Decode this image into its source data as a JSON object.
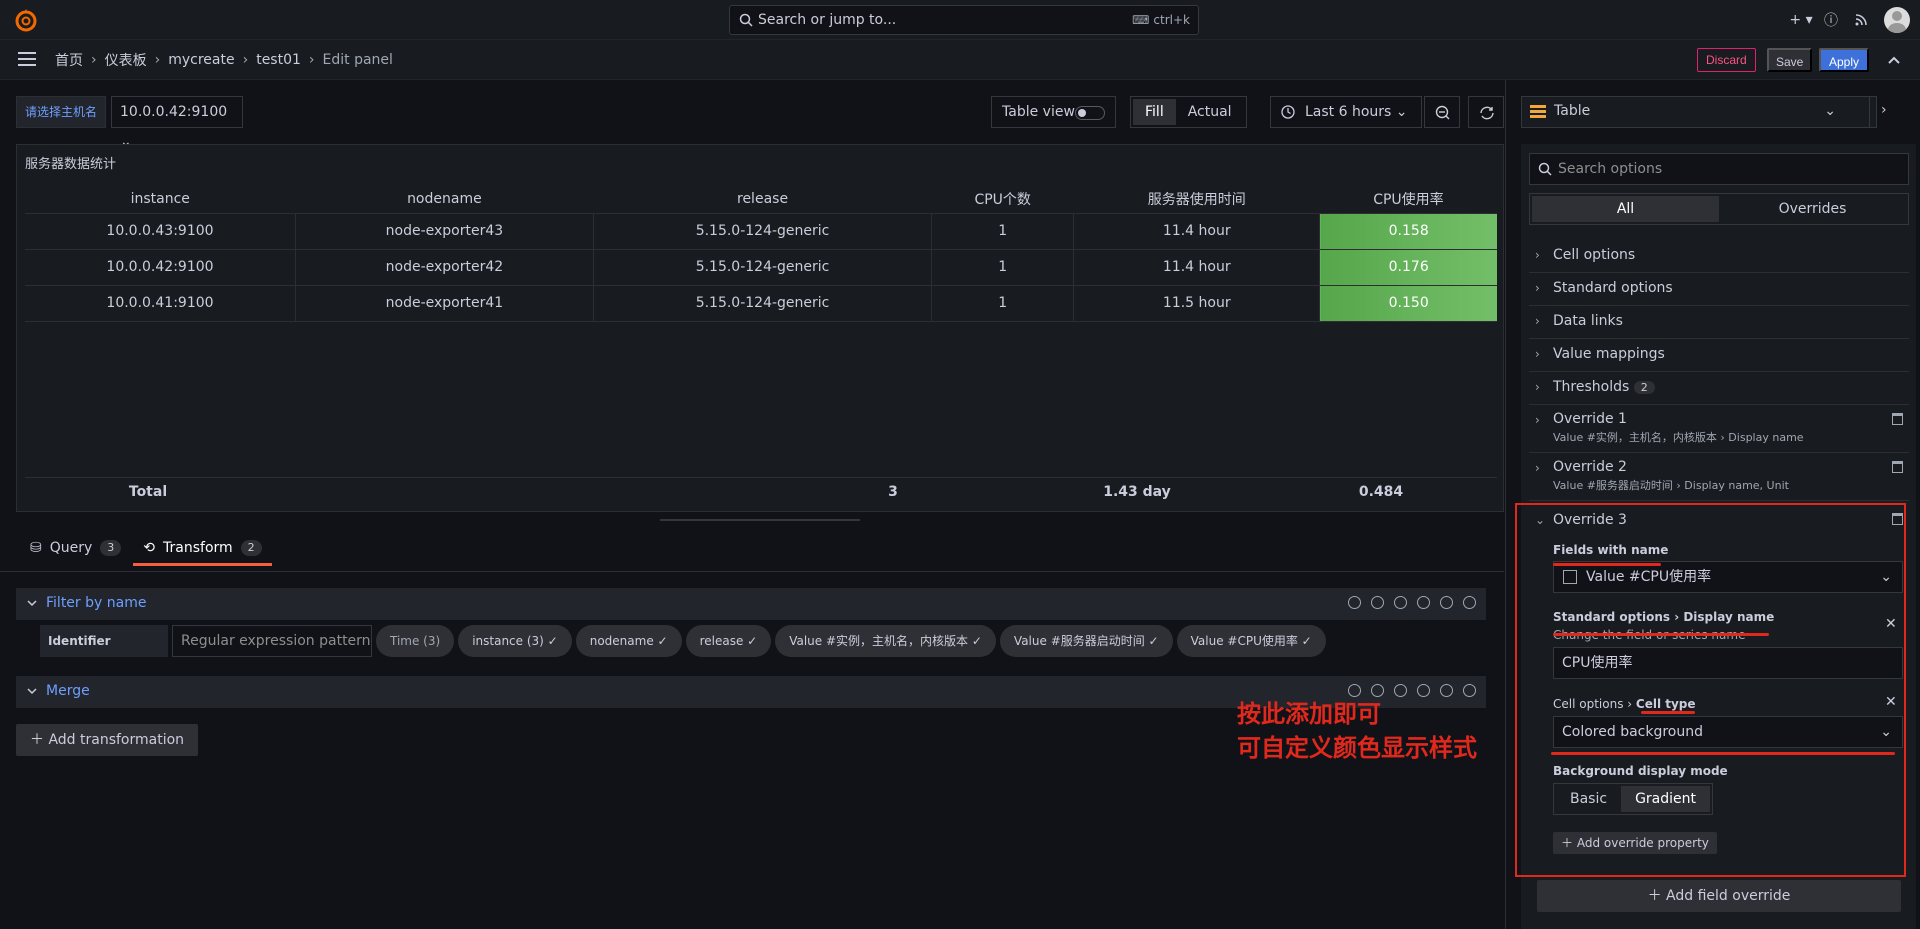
{
  "topbar": {
    "search_placeholder": "Search or jump to...",
    "search_shortcut": "ctrl+k"
  },
  "breadcrumb": {
    "items": [
      "首页",
      "仪表板",
      "mycreate",
      "test01",
      "Edit panel"
    ]
  },
  "actions": {
    "discard": "Discard",
    "save": "Save",
    "apply": "Apply"
  },
  "toolbar": {
    "variable_label": "请选择主机名",
    "variable_value": "10.0.0.42:9100",
    "table_view": "Table view",
    "fill": "Fill",
    "actual": "Actual",
    "time_range": "Last 6 hours"
  },
  "panel": {
    "title": "服务器数据统计",
    "columns": [
      "instance",
      "nodename",
      "release",
      "CPU个数",
      "服务器使用时间",
      "CPU使用率"
    ],
    "rows": [
      [
        "10.0.0.43:9100",
        "node-exporter43",
        "5.15.0-124-generic",
        "1",
        "11.4 hour",
        "0.158"
      ],
      [
        "10.0.0.42:9100",
        "node-exporter42",
        "5.15.0-124-generic",
        "1",
        "11.4 hour",
        "0.176"
      ],
      [
        "10.0.0.41:9100",
        "node-exporter41",
        "5.15.0-124-generic",
        "1",
        "11.5 hour",
        "0.150"
      ]
    ],
    "footer": {
      "label": "Total",
      "cpu_count": "3",
      "uptime": "1.43 day",
      "cpu_rate": "0.484"
    }
  },
  "tabs": [
    {
      "label": "Query",
      "count": "3"
    },
    {
      "label": "Transform",
      "count": "2"
    }
  ],
  "transforms": {
    "filter_title": "Filter by name",
    "identifier": "Identifier",
    "regex_placeholder": "Regular expression pattern",
    "chips": [
      "Time (3)",
      "instance (3) ✓",
      "nodename ✓",
      "release ✓",
      "Value #实例，主机名，内核版本 ✓",
      "Value #服务器启动时间 ✓",
      "Value #CPU使用率 ✓"
    ],
    "merge_title": "Merge",
    "add_label": "Add transformation"
  },
  "sidebar": {
    "viz": "Table",
    "search_placeholder": "Search options",
    "seg_all": "All",
    "seg_overrides": "Overrides",
    "sections": [
      "Cell options",
      "Standard options",
      "Data links",
      "Value mappings",
      "Thresholds"
    ],
    "thresholds_count": "2",
    "override1": {
      "title": "Override 1",
      "sub": "Value #实例，主机名，内核版本  ›  Display name"
    },
    "override2": {
      "title": "Override 2",
      "sub": "Value #服务器启动时间  ›  Display name, Unit"
    },
    "override3": {
      "title": "Override 3",
      "fields_label": "Fields with name",
      "fields_value": "Value #CPU使用率",
      "std_label": "Standard options",
      "display_name": "Display name",
      "display_desc": "Change the field or series name",
      "display_value": "CPU使用率",
      "cell_label": "Cell options",
      "cell_type": "Cell type",
      "cell_value": "Colored background",
      "bg_mode_label": "Background display mode",
      "bg_basic": "Basic",
      "bg_gradient": "Gradient",
      "add_property": "Add override property"
    },
    "add_field_override": "Add field override"
  },
  "annotation": {
    "line1": "按此添加即可",
    "line2": "可自定义颜色显示样式"
  },
  "colors": {
    "accent": "#3d71d9",
    "cell_bg": "#56a64b",
    "annotation_red": "#e1281c"
  }
}
